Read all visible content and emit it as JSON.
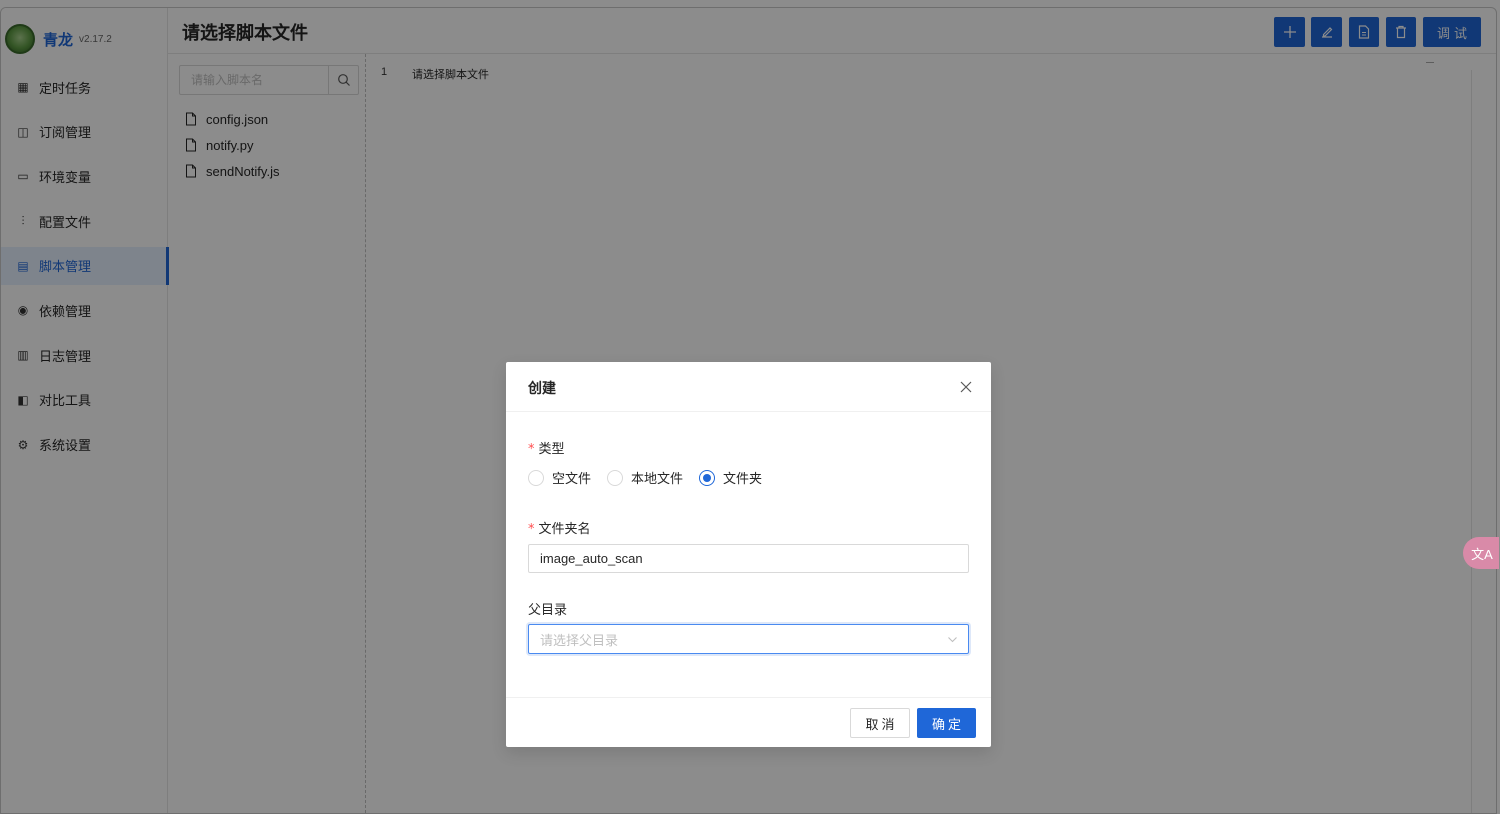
{
  "app": {
    "name": "青龙",
    "version": "v2.17.2"
  },
  "sidebar": {
    "items": [
      {
        "label": "定时任务",
        "icon": "calendar-icon",
        "glyph": "▦"
      },
      {
        "label": "订阅管理",
        "icon": "subscription-icon",
        "glyph": "◫"
      },
      {
        "label": "环境变量",
        "icon": "monitor-icon",
        "glyph": "▭"
      },
      {
        "label": "配置文件",
        "icon": "sliders-icon",
        "glyph": "⫶"
      },
      {
        "label": "脚本管理",
        "icon": "script-icon",
        "glyph": "▤"
      },
      {
        "label": "依赖管理",
        "icon": "dependency-icon",
        "glyph": "◉"
      },
      {
        "label": "日志管理",
        "icon": "log-icon",
        "glyph": "▥"
      },
      {
        "label": "对比工具",
        "icon": "diff-icon",
        "glyph": "◧"
      },
      {
        "label": "系统设置",
        "icon": "gear-icon",
        "glyph": "⚙"
      }
    ],
    "active_index": 4
  },
  "header": {
    "title": "请选择脚本文件",
    "debug_label": "调试"
  },
  "tree": {
    "search_placeholder": "请输入脚本名",
    "files": [
      "config.json",
      "notify.py",
      "sendNotify.js"
    ]
  },
  "editor": {
    "line_number": "1",
    "line_text": "请选择脚本文件"
  },
  "translate_bubble": "文A",
  "modal": {
    "title": "创建",
    "type_label": "类型",
    "type_options": [
      "空文件",
      "本地文件",
      "文件夹"
    ],
    "type_selected": "文件夹",
    "folder_name_label": "文件夹名",
    "folder_name_value": "image_auto_scan",
    "parent_dir_label": "父目录",
    "parent_dir_placeholder": "请选择父目录",
    "cancel_label": "取消",
    "ok_label": "确定"
  },
  "colors": {
    "primary": "#1f67d8",
    "required": "#ff4d4f",
    "mask": "rgba(0,0,0,0.45)"
  }
}
